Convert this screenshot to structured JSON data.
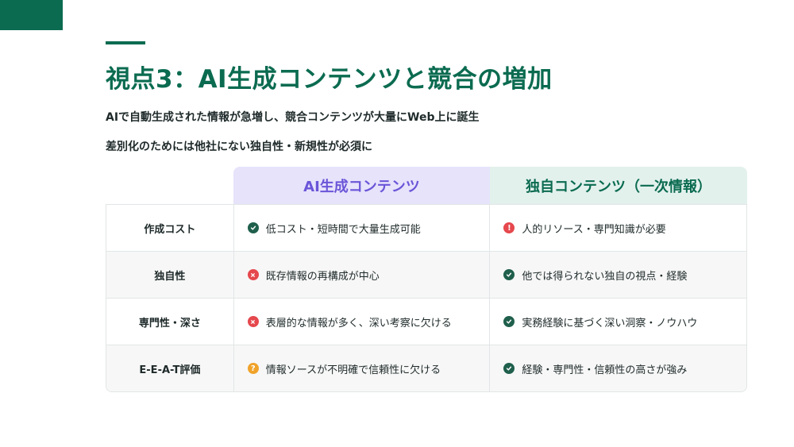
{
  "title": "視点3：AI生成コンテンツと競合の増加",
  "lead": [
    "AIで自動生成された情報が急増し、競合コンテンツが大量にWeb上に誕生",
    "差別化のためには他社にない独自性・新規性が必須に"
  ],
  "table": {
    "columns": [
      "AI生成コンテンツ",
      "独自コンテンツ（一次情報）"
    ],
    "rows": [
      {
        "label": "作成コスト",
        "ai": {
          "icon": "check-circle-icon",
          "text": "低コスト・短時間で大量生成可能"
        },
        "own": {
          "icon": "exclamation-circle-icon",
          "text": "人的リソース・専門知識が必要"
        }
      },
      {
        "label": "独自性",
        "ai": {
          "icon": "x-circle-icon",
          "text": "既存情報の再構成が中心"
        },
        "own": {
          "icon": "check-circle-icon",
          "text": "他では得られない独自の視点・経験"
        }
      },
      {
        "label": "専門性・深さ",
        "ai": {
          "icon": "x-circle-icon",
          "text": "表層的な情報が多く、深い考察に欠ける"
        },
        "own": {
          "icon": "check-circle-icon",
          "text": "実務経験に基づく深い洞察・ノウハウ"
        }
      },
      {
        "label": "E-E-A-T評価",
        "ai": {
          "icon": "question-circle-icon",
          "text": "情報ソースが不明確で信頼性に欠ける"
        },
        "own": {
          "icon": "check-circle-icon",
          "text": "経験・専門性・信頼性の高さが強み"
        }
      }
    ]
  },
  "colors": {
    "brand": "#0b6b50",
    "ai_header_bg": "#e6e3fb",
    "ai_header_text": "#6b55d8",
    "own_header_bg": "#e3f1ed",
    "check": "#1f5f4c",
    "cross": "#e5484d",
    "question": "#f0a32a"
  }
}
